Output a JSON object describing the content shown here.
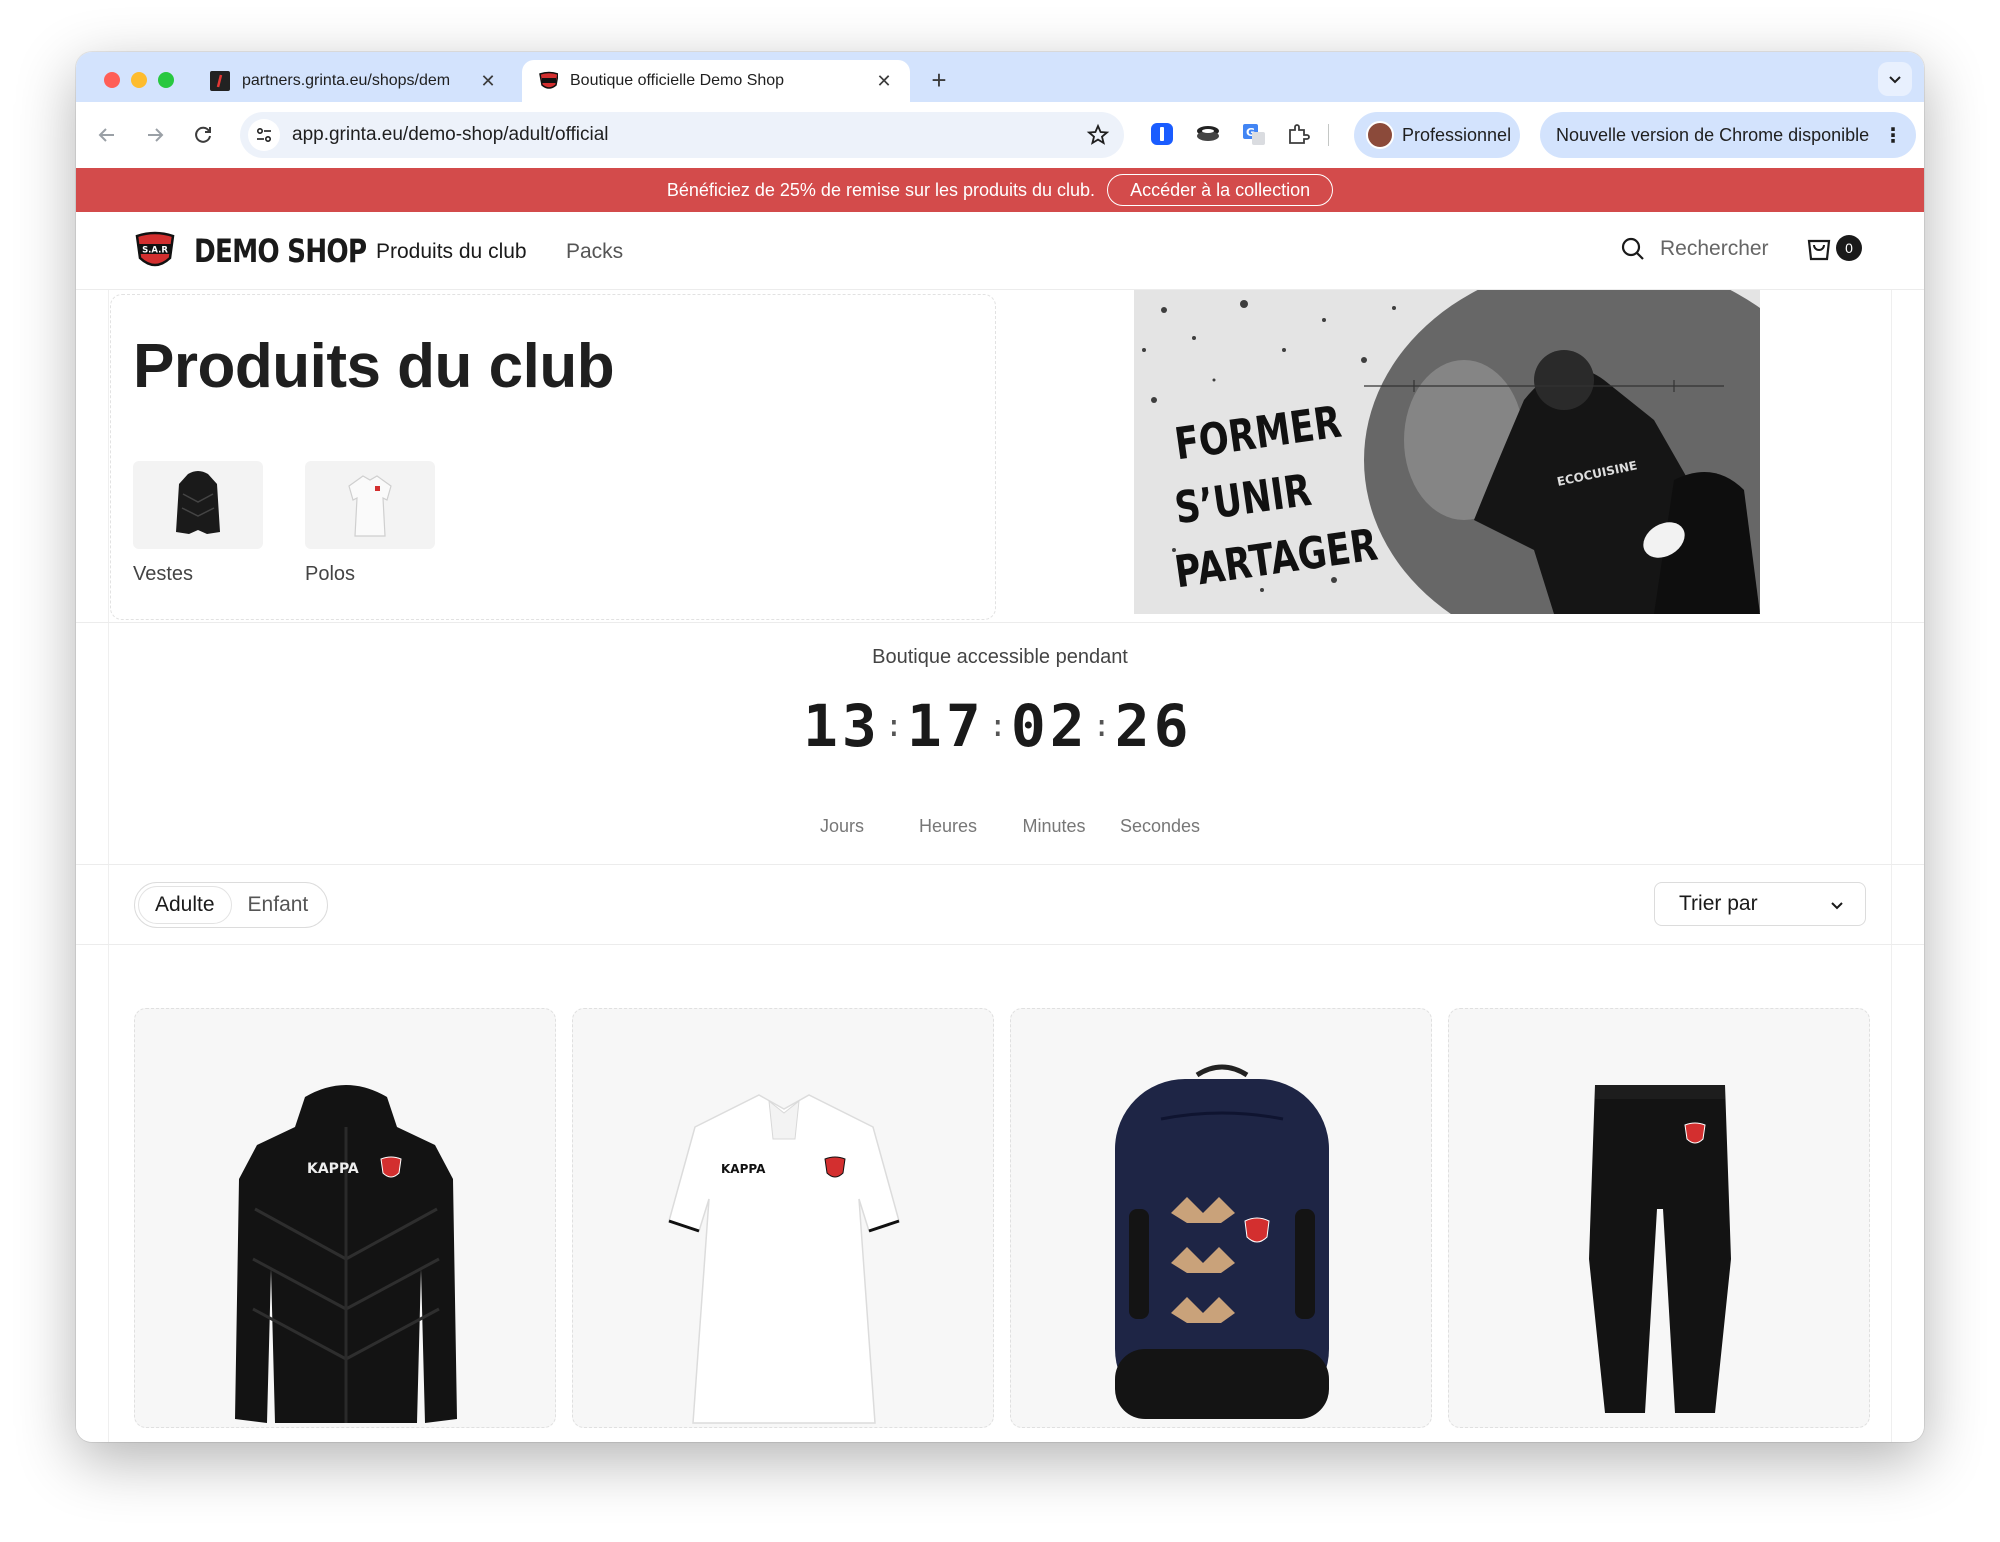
{
  "browser": {
    "tabs": [
      {
        "title": "partners.grinta.eu/shops/dem",
        "active": false
      },
      {
        "title": "Boutique officielle Demo Shop",
        "active": true
      }
    ],
    "url": "app.grinta.eu/demo-shop/adult/official",
    "profile_label": "Professionnel",
    "update_label": "Nouvelle version de Chrome disponible",
    "accent": "#d3e3fd"
  },
  "announcement": {
    "text": "Bénéficiez de 25% de remise sur les produits du club.",
    "button": "Accéder à la collection",
    "color": "#d34b4b"
  },
  "header": {
    "brand": "DEMO SHOP",
    "logo_text": "S.A.R",
    "nav": [
      "Produits du club",
      "Packs"
    ],
    "search_label": "Rechercher",
    "cart_count": "0"
  },
  "hero": {
    "title": "Produits du club",
    "categories": [
      {
        "label": "Vestes",
        "icon": "jacket-icon"
      },
      {
        "label": "Polos",
        "icon": "polo-icon"
      }
    ],
    "banner_lines": [
      "FORMER",
      "S’UNIR",
      "PARTAGER"
    ],
    "banner_sponsor": "ECOCUISINE"
  },
  "countdown": {
    "label": "Boutique accessible pendant",
    "values": [
      "13",
      "17",
      "02",
      "26"
    ],
    "units": [
      "Jours",
      "Heures",
      "Minutes",
      "Secondes"
    ]
  },
  "filters": {
    "segments": [
      "Adulte",
      "Enfant"
    ],
    "selected": "Adulte",
    "sort_label": "Trier par"
  },
  "products": [
    {
      "kind": "jacket",
      "color": "#111111"
    },
    {
      "kind": "polo",
      "color": "#ffffff"
    },
    {
      "kind": "backpack",
      "color": "#1e2545"
    },
    {
      "kind": "pants",
      "color": "#111111"
    }
  ]
}
